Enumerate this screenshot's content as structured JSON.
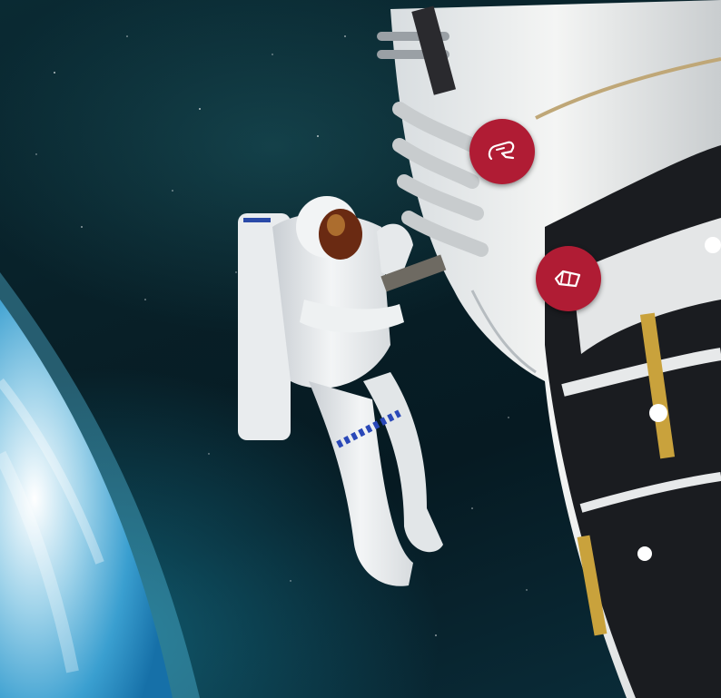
{
  "scene": {
    "subject": "astronaut-spacewalk",
    "colors": {
      "space": "#082028",
      "earth_atmosphere": "#1aa6d6",
      "hotspot": "#b01c34",
      "suit": "#eef1f3"
    }
  },
  "hotspots": [
    {
      "icon": "tether-hook-icon"
    },
    {
      "icon": "tool-module-icon"
    }
  ]
}
